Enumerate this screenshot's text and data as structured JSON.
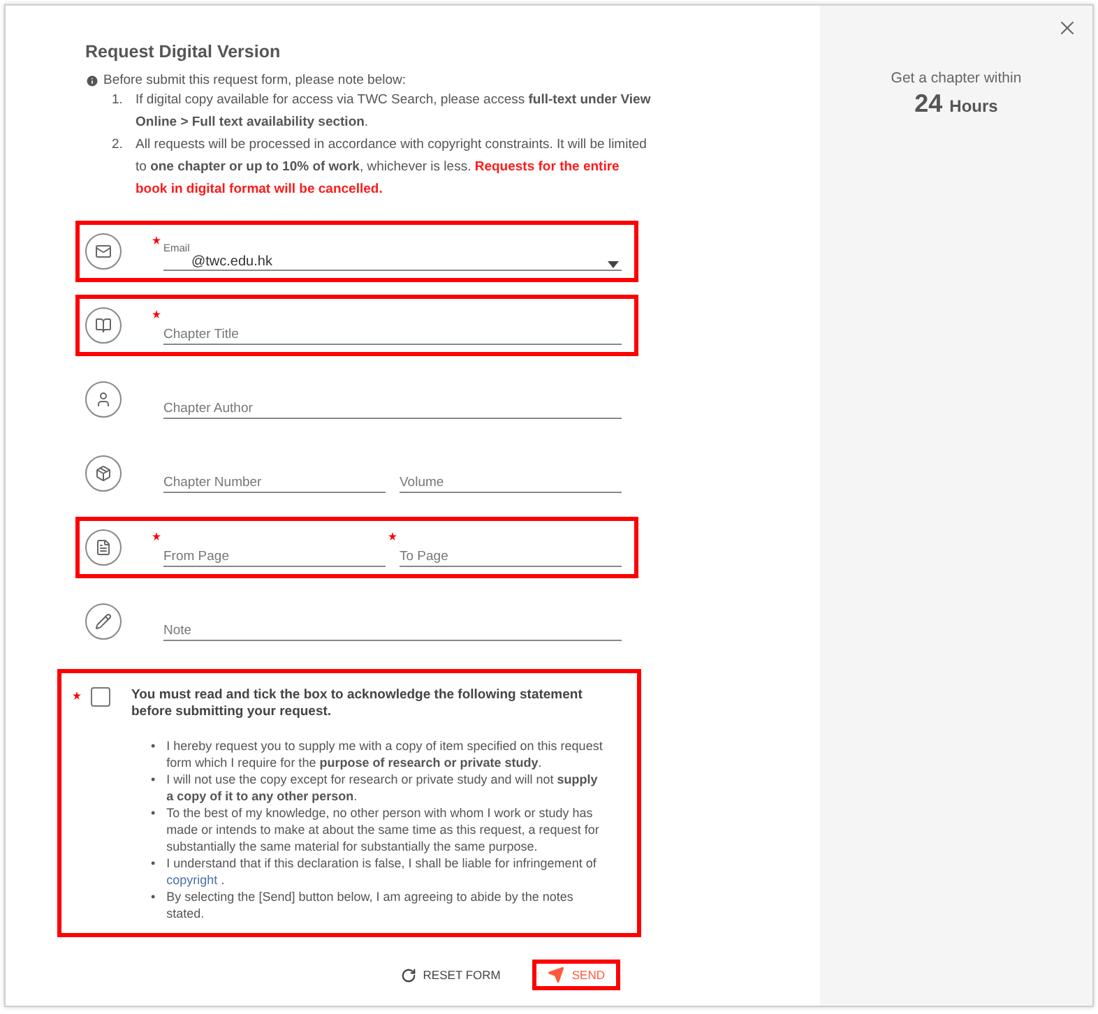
{
  "title": "Request Digital Version",
  "notice": {
    "intro": "Before submit this request form, please note below:",
    "items": [
      {
        "marker": "1.",
        "text": "If digital copy available for access via TWC Search, please access **full-text under View Online > Full text availability section**."
      },
      {
        "marker": "2.",
        "text": "All requests will be processed in accordance with copyright constraints. It will be limited to **one chapter or up to 10% of work**, whichever is less.",
        "warning": "Requests for the entire book in digital format will be cancelled."
      }
    ]
  },
  "rows": [
    {
      "kind": "mail",
      "highlighted": true,
      "fields": [
        {
          "kind": "select",
          "label": "Email",
          "value": "@twc.edu.hk",
          "required": true
        }
      ]
    },
    {
      "kind": "book",
      "highlighted": true,
      "fields": [
        {
          "kind": "text",
          "placeholder": "Chapter Title",
          "required": true
        }
      ]
    },
    {
      "kind": "person",
      "highlighted": false,
      "fields": [
        {
          "kind": "text",
          "placeholder": "Chapter Author",
          "required": false
        }
      ]
    },
    {
      "kind": "package",
      "highlighted": false,
      "fields": [
        {
          "kind": "text",
          "placeholder": "Chapter Number",
          "required": false
        },
        {
          "kind": "text",
          "placeholder": "Volume",
          "required": false
        }
      ]
    },
    {
      "kind": "page",
      "highlighted": true,
      "fields": [
        {
          "kind": "text",
          "placeholder": "From Page",
          "required": true
        },
        {
          "kind": "text",
          "placeholder": "To Page",
          "required": true
        }
      ]
    },
    {
      "kind": "pencil",
      "highlighted": false,
      "fields": [
        {
          "kind": "text",
          "placeholder": "Note",
          "required": false
        }
      ]
    }
  ],
  "acknowledgement": {
    "required": true,
    "checked": false,
    "highlighted": true,
    "statement": "You must read and tick the box to acknowledge the following statement before submitting your request.",
    "bullets": [
      {
        "marker": "•",
        "text": "I hereby request you to supply me with a copy of item specified on this request form which I require for the **purpose of research or private study**."
      },
      {
        "marker": "•",
        "text": "I will not use the copy except for research or private study and will not **supply a copy of it to any other person**."
      },
      {
        "marker": "•",
        "text": "To the best of my knowledge, no other person with whom I work or study has made or intends to make at about the same time as this request, a request for substantially the same material for substantially the same purpose."
      },
      {
        "marker": "•",
        "text": "I understand that if this declaration is false, I shall be liable for infringement of",
        "link": "copyright",
        "tail": "."
      },
      {
        "marker": "•",
        "text": "By selecting the [Send] button below, I am agreeing to abide by the notes stated."
      }
    ]
  },
  "buttons": [
    {
      "kind": "reset",
      "label": "RESET FORM",
      "highlighted": false
    },
    {
      "kind": "send",
      "label": "SEND",
      "highlighted": true
    }
  ],
  "side": {
    "caption": "Get a chapter within",
    "number": "24",
    "unit": "Hours"
  }
}
